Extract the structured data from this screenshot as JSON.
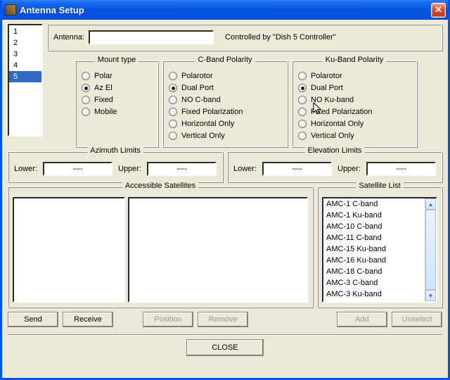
{
  "window": {
    "title": "Antenna Setup"
  },
  "antennaList": {
    "items": [
      "1",
      "2",
      "3",
      "4",
      "5"
    ],
    "selected": "5"
  },
  "header": {
    "antenna_label": "Antenna:",
    "antenna_value": "",
    "controlled_by": "Controlled by \"Dish 5 Controller\""
  },
  "mount": {
    "legend": "Mount type",
    "options": [
      "Polar",
      "Az El",
      "Fixed",
      "Mobile"
    ],
    "selected": "Az El"
  },
  "cband": {
    "legend": "C-Band Polarity",
    "options": [
      "Polarotor",
      "Dual Port",
      "NO C-band",
      "Fixed Polarization",
      "Horizontal Only",
      "Vertical Only"
    ],
    "selected": "Dual Port"
  },
  "kuband": {
    "legend": "Ku-Band Polarity",
    "options": [
      "Polarotor",
      "Dual Port",
      "NO Ku-band",
      "Fixed Polarization",
      "Horizontal Only",
      "Vertical Only"
    ],
    "selected": "Dual Port"
  },
  "limits": {
    "azimuth": {
      "legend": "Azimuth Limits",
      "lower_label": "Lower:",
      "lower": "----",
      "upper_label": "Upper:",
      "upper": "----"
    },
    "elevation": {
      "legend": "Elevation Limits",
      "lower_label": "Lower:",
      "lower": "----",
      "upper_label": "Upper:",
      "upper": "----"
    }
  },
  "accessible": {
    "legend": "Accessible Satellites"
  },
  "satlist": {
    "legend": "Satellite List",
    "items": [
      "AMC-1  C-band",
      "AMC-1  Ku-band",
      "AMC-10  C-band",
      "AMC-11  C-band",
      "AMC-15  Ku-band",
      "AMC-16  Ku-band",
      "AMC-18  C-band",
      "AMC-3  C-band",
      "AMC-3  Ku-band"
    ]
  },
  "buttons": {
    "send": "Send",
    "receive": "Receive",
    "position": "Position",
    "remove": "Remove",
    "add": "Add",
    "unselect": "Unselect",
    "close": "CLOSE"
  }
}
